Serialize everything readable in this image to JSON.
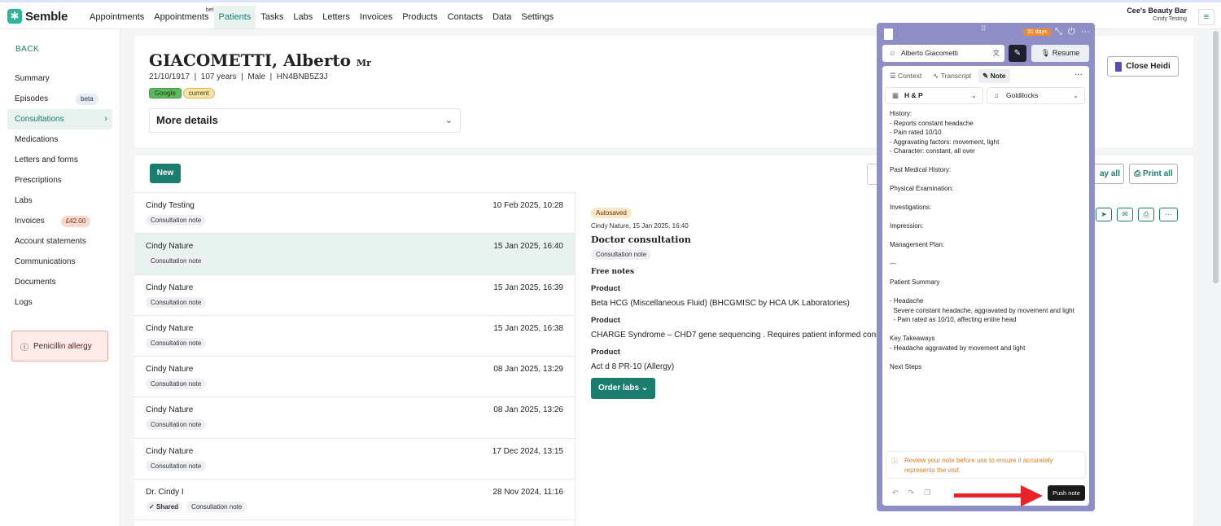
{
  "app": {
    "logo_text": "Semble",
    "org_name": "Cee's Beauty Bar",
    "org_user": "Cindy Testing"
  },
  "nav": [
    {
      "label": "Appointments"
    },
    {
      "label": "Appointments",
      "badge": "beta"
    },
    {
      "label": "Patients"
    },
    {
      "label": "Tasks"
    },
    {
      "label": "Labs"
    },
    {
      "label": "Letters"
    },
    {
      "label": "Invoices"
    },
    {
      "label": "Products"
    },
    {
      "label": "Contacts"
    },
    {
      "label": "Data"
    },
    {
      "label": "Settings"
    }
  ],
  "sidebar": {
    "back_label": "BACK",
    "items": [
      {
        "label": "Summary"
      },
      {
        "label": "Episodes",
        "badge": "beta"
      },
      {
        "label": "Consultations",
        "chevron": "›"
      },
      {
        "label": "Medications"
      },
      {
        "label": "Letters and forms"
      },
      {
        "label": "Prescriptions"
      },
      {
        "label": "Labs"
      },
      {
        "label": "Invoices",
        "badge": "£42.00"
      },
      {
        "label": "Account statements"
      },
      {
        "label": "Communications"
      },
      {
        "label": "Documents"
      },
      {
        "label": "Logs"
      }
    ],
    "allergy_label": "Penicillin allergy"
  },
  "patient": {
    "name": "GIACOMETTI, Alberto",
    "title": "Mr",
    "meta": "21/10/1917  |  107 years  |  Male  |  HN4BNB5Z3J",
    "tags": [
      "Google",
      "current"
    ],
    "more_details_label": "More details",
    "close_heidi_label": "Close Heidi"
  },
  "consultations": {
    "new_label": "New",
    "play_all_label": "ay all",
    "print_all_label": "Print all",
    "rows": [
      {
        "name": "Cindy Testing",
        "date": "10 Feb 2025, 10:28",
        "tags": [
          "Consultation note"
        ]
      },
      {
        "name": "Cindy Nature",
        "date": "15 Jan 2025, 16:40",
        "tags": [
          "Consultation note"
        ]
      },
      {
        "name": "Cindy Nature",
        "date": "15 Jan 2025, 16:39",
        "tags": [
          "Consultation note"
        ]
      },
      {
        "name": "Cindy Nature",
        "date": "15 Jan 2025, 16:38",
        "tags": [
          "Consultation note"
        ]
      },
      {
        "name": "Cindy Nature",
        "date": "08 Jan 2025, 13:29",
        "tags": [
          "Consultation note"
        ]
      },
      {
        "name": "Cindy Nature",
        "date": "08 Jan 2025, 13:26",
        "tags": [
          "Consultation note"
        ]
      },
      {
        "name": "Cindy Nature",
        "date": "17 Dec 2024, 13:15",
        "tags": [
          "Consultation note"
        ]
      },
      {
        "name": "Dr. Cindy I",
        "date": "28 Nov 2024, 11:16",
        "shared": "✓ Shared",
        "tags": [
          "Consultation note"
        ]
      }
    ],
    "detail": {
      "status": "Autosaved",
      "subtitle": "Cindy Nature, 15 Jan 2025, 16:40",
      "title": "Doctor consultation",
      "tag": "Consultation note",
      "free_notes_label": "Free notes",
      "products": [
        {
          "label": "Product",
          "text": "Beta HCG (Miscellaneous Fluid) (BHCGMISC by HCA UK Laboratories)"
        },
        {
          "label": "Product",
          "text": "CHARGE Syndrome – CHD7 gene sequencing . Requires patient informed consent"
        },
        {
          "label": "Product",
          "text": "Act d 8 PR-10 (Allergy)"
        }
      ],
      "order_labs_label": "Order labs"
    }
  },
  "heidi": {
    "trial_badge": "31 days",
    "patient_name": "Alberto Giacometti",
    "resume_label": "Resume",
    "tabs": {
      "context": "Context",
      "transcript": "Transcript",
      "note": "Note"
    },
    "template": "H & P",
    "voice": "Goldilocks",
    "note_text": "History:\n- Reports constant headache\n- Pain rated 10/10\n- Aggravating factors: movement, light\n- Character: constant, all over\n\nPast Medical History:\n\nPhysical Examination:\n\nInvestigations:\n\nImpression:\n\nManagement Plan:\n\n---\n\nPatient Summary\n\n- Headache\n  Severe constant headache, aggravated by movement and light\n  - Pain rated as 10/10, affecting entire head\n\nKey Takeaways\n- Headache aggravated by movement and light\n\nNext Steps",
    "warning": "Review your note before use to ensure it accurately represents the visit.",
    "push_label": "Push note"
  },
  "colors": {
    "brand": "#1b7d6d",
    "heidi": "#8f8ec6",
    "annotation_arrow": "#e8242a"
  }
}
